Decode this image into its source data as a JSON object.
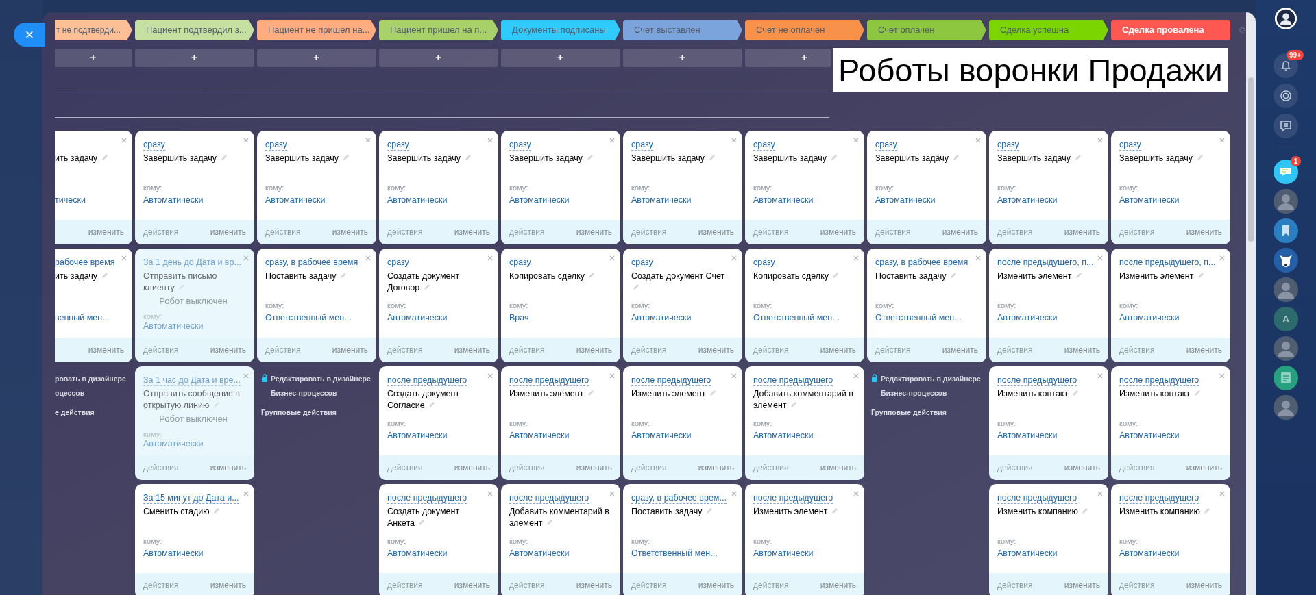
{
  "close_button": {
    "label": "×"
  },
  "stages": [
    {
      "label": "т не подтверди...",
      "color": "#fdbf95",
      "kind": "process"
    },
    {
      "label": "Пациент подтвердил з...",
      "color": "#c5e0a0",
      "kind": "process"
    },
    {
      "label": "Пациент не пришел на...",
      "color": "#ffac80",
      "kind": "process"
    },
    {
      "label": "Пациент пришел на п...",
      "color": "#a8d16a",
      "kind": "process"
    },
    {
      "label": "Документы подписаны",
      "color": "#2fcbfd",
      "kind": "process"
    },
    {
      "label": "Счет выставлен",
      "color": "#7ca4dc",
      "kind": "process"
    },
    {
      "label": "Счет не оплачен",
      "color": "#f8914a",
      "kind": "process"
    },
    {
      "label": "Счет оплачен",
      "color": "#8dc63f",
      "kind": "process"
    },
    {
      "label": "Сделка успешна",
      "color": "#7bd500",
      "kind": "process"
    },
    {
      "label": "Сделка провалена",
      "color": "#ff5752",
      "kind": "failure"
    }
  ],
  "add_buttons": [
    "+",
    "+",
    "+",
    "+",
    "+",
    "+",
    "+"
  ],
  "overlay_title": "Роботы воронки Продажи",
  "columns": [
    {
      "items": [
        {
          "kind": "robot",
          "action": "ить задачу",
          "to_value": "тически",
          "edit_label": "изменить",
          "disabled": false
        },
        {
          "kind": "robot",
          "trigger": "рабочее время",
          "action": "ить задачу",
          "to_value": "венный мен...",
          "edit_label": "изменить",
          "disabled": false
        },
        {
          "kind": "designer",
          "lock": false,
          "link_lines": [
            "ровать в дизайнере",
            "оцессов"
          ],
          "group": "е действия"
        }
      ]
    },
    {
      "items": [
        {
          "kind": "robot",
          "trigger": "сразу",
          "action": "Завершить задачу",
          "to_label": "кому:",
          "to_value": "Автоматически",
          "actions_label": "действия",
          "edit_label": "изменить",
          "disabled": false
        },
        {
          "kind": "robot",
          "trigger": "За 1 день до Дата и вр...",
          "action": "Отправить письмо клиенту",
          "to_label": "кому:",
          "to_value": "Автоматически",
          "actions_label": "действия",
          "edit_label": "изменить",
          "disabled": true,
          "note": "Робот выключен"
        },
        {
          "kind": "robot",
          "trigger": "За 1 час до Дата и вре...",
          "action": "Отправить сообщение в открытую линию",
          "to_label": "кому:",
          "to_value": "Автоматически",
          "actions_label": "действия",
          "edit_label": "изменить",
          "disabled": true,
          "note": "Робот выключен"
        },
        {
          "kind": "robot",
          "trigger": "За 15 минут до Дата и...",
          "action": "Сменить стадию",
          "to_label": "кому:",
          "to_value": "Автоматически",
          "actions_label": "действия",
          "edit_label": "изменить",
          "disabled": false
        }
      ]
    },
    {
      "items": [
        {
          "kind": "robot",
          "trigger": "сразу",
          "action": "Завершить задачу",
          "to_label": "кому:",
          "to_value": "Автоматически",
          "actions_label": "действия",
          "edit_label": "изменить",
          "disabled": false
        },
        {
          "kind": "robot",
          "trigger": "сразу, в рабочее время",
          "action": "Поставить задачу",
          "to_label": "кому:",
          "to_value": "Ответственный мен...",
          "actions_label": "действия",
          "edit_label": "изменить",
          "disabled": false
        },
        {
          "kind": "designer",
          "lock": true,
          "link_lines": [
            "Редактировать в дизайнере",
            "Бизнес-процессов"
          ],
          "group": "Групповые действия"
        }
      ]
    },
    {
      "items": [
        {
          "kind": "robot",
          "trigger": "сразу",
          "action": "Завершить задачу",
          "to_label": "кому:",
          "to_value": "Автоматически",
          "actions_label": "действия",
          "edit_label": "изменить",
          "disabled": false
        },
        {
          "kind": "robot",
          "trigger": "сразу",
          "action": "Создать документ Договор",
          "to_label": "кому:",
          "to_value": "Автоматически",
          "actions_label": "действия",
          "edit_label": "изменить",
          "disabled": false
        },
        {
          "kind": "robot",
          "trigger": "после предыдущего",
          "action": "Создать документ Согласие",
          "to_label": "кому:",
          "to_value": "Автоматически",
          "actions_label": "действия",
          "edit_label": "изменить",
          "disabled": false
        },
        {
          "kind": "robot",
          "trigger": "после предыдущего",
          "action": "Создать документ Анкета",
          "to_label": "кому:",
          "to_value": "Автоматически",
          "actions_label": "действия",
          "edit_label": "изменить",
          "disabled": false
        }
      ]
    },
    {
      "items": [
        {
          "kind": "robot",
          "trigger": "сразу",
          "action": "Завершить задачу",
          "to_label": "кому:",
          "to_value": "Автоматически",
          "actions_label": "действия",
          "edit_label": "изменить",
          "disabled": false
        },
        {
          "kind": "robot",
          "trigger": "сразу",
          "action": "Копировать сделку",
          "to_label": "кому:",
          "to_value": "Врач",
          "actions_label": "действия",
          "edit_label": "изменить",
          "disabled": false
        },
        {
          "kind": "robot",
          "trigger": "после предыдущего",
          "action": "Изменить элемент",
          "to_label": "кому:",
          "to_value": "Автоматически",
          "actions_label": "действия",
          "edit_label": "изменить",
          "disabled": false
        },
        {
          "kind": "robot",
          "trigger": "после предыдущего",
          "action": "Добавить комментарий в элемент",
          "to_label": "кому:",
          "to_value": "Автоматически",
          "actions_label": "действия",
          "edit_label": "изменить",
          "disabled": false
        }
      ]
    },
    {
      "items": [
        {
          "kind": "robot",
          "trigger": "сразу",
          "action": "Завершить задачу",
          "to_label": "кому:",
          "to_value": "Автоматически",
          "actions_label": "действия",
          "edit_label": "изменить",
          "disabled": false
        },
        {
          "kind": "robot",
          "trigger": "сразу",
          "action": "Создать документ Счет",
          "to_label": "кому:",
          "to_value": "Автоматически",
          "actions_label": "действия",
          "edit_label": "изменить",
          "disabled": false
        },
        {
          "kind": "robot",
          "trigger": "после предыдущего",
          "action": "Изменить элемент",
          "to_label": "кому:",
          "to_value": "Автоматически",
          "actions_label": "действия",
          "edit_label": "изменить",
          "disabled": false
        },
        {
          "kind": "robot",
          "trigger": "сразу, в рабочее врем...",
          "action": "Поставить задачу",
          "to_label": "кому:",
          "to_value": "Ответственный мен...",
          "actions_label": "действия",
          "edit_label": "изменить",
          "disabled": false
        }
      ]
    },
    {
      "items": [
        {
          "kind": "robot",
          "trigger": "сразу",
          "action": "Завершить задачу",
          "to_label": "кому:",
          "to_value": "Автоматически",
          "actions_label": "действия",
          "edit_label": "изменить",
          "disabled": false
        },
        {
          "kind": "robot",
          "trigger": "сразу",
          "action": "Копировать сделку",
          "to_label": "кому:",
          "to_value": "Ответственный мен...",
          "actions_label": "действия",
          "edit_label": "изменить",
          "disabled": false
        },
        {
          "kind": "robot",
          "trigger": "после предыдущего",
          "action": "Добавить комментарий в элемент",
          "to_label": "кому:",
          "to_value": "Автоматически",
          "actions_label": "действия",
          "edit_label": "изменить",
          "disabled": false
        },
        {
          "kind": "robot",
          "trigger": "после предыдущего",
          "action": "Изменить элемент",
          "to_label": "кому:",
          "to_value": "Автоматически",
          "actions_label": "действия",
          "edit_label": "изменить",
          "disabled": false
        }
      ]
    },
    {
      "items": [
        {
          "kind": "robot",
          "trigger": "сразу",
          "action": "Завершить задачу",
          "to_label": "кому:",
          "to_value": "Автоматически",
          "actions_label": "действия",
          "edit_label": "изменить",
          "disabled": false
        },
        {
          "kind": "robot",
          "trigger": "сразу, в рабочее время",
          "action": "Поставить задачу",
          "to_label": "кому:",
          "to_value": "Ответственный мен...",
          "actions_label": "действия",
          "edit_label": "изменить",
          "disabled": false
        },
        {
          "kind": "designer",
          "lock": true,
          "link_lines": [
            "Редактировать в дизайнере",
            "Бизнес-процессов"
          ],
          "group": "Групповые действия"
        }
      ]
    },
    {
      "items": [
        {
          "kind": "robot",
          "trigger": "сразу",
          "action": "Завершить задачу",
          "to_label": "кому:",
          "to_value": "Автоматически",
          "actions_label": "действия",
          "edit_label": "изменить",
          "disabled": false
        },
        {
          "kind": "robot",
          "trigger": "после предыдущего, п...",
          "action": "Изменить элемент",
          "to_label": "кому:",
          "to_value": "Автоматически",
          "actions_label": "действия",
          "edit_label": "изменить",
          "disabled": false
        },
        {
          "kind": "robot",
          "trigger": "после предыдущего",
          "action": "Изменить контакт",
          "to_label": "кому:",
          "to_value": "Автоматически",
          "actions_label": "действия",
          "edit_label": "изменить",
          "disabled": false
        },
        {
          "kind": "robot",
          "trigger": "после предыдущего",
          "action": "Изменить компанию",
          "to_label": "кому:",
          "to_value": "Автоматически",
          "actions_label": "действия",
          "edit_label": "изменить",
          "disabled": false
        }
      ]
    },
    {
      "items": [
        {
          "kind": "robot",
          "trigger": "сразу",
          "action": "Завершить задачу",
          "to_label": "кому:",
          "to_value": "Автоматически",
          "actions_label": "действия",
          "edit_label": "изменить",
          "disabled": false
        },
        {
          "kind": "robot",
          "trigger": "после предыдущего, п...",
          "action": "Изменить элемент",
          "to_label": "кому:",
          "to_value": "Автоматически",
          "actions_label": "действия",
          "edit_label": "изменить",
          "disabled": false
        },
        {
          "kind": "robot",
          "trigger": "после предыдущего",
          "action": "Изменить контакт",
          "to_label": "кому:",
          "to_value": "Автоматически",
          "actions_label": "действия",
          "edit_label": "изменить",
          "disabled": false
        },
        {
          "kind": "robot",
          "trigger": "после предыдущего",
          "action": "Изменить компанию",
          "to_label": "кому:",
          "to_value": "Автоматически",
          "actions_label": "действия",
          "edit_label": "изменить",
          "disabled": false
        }
      ]
    }
  ],
  "right_sidebar": {
    "notifications_badge": "99+",
    "chat_badge": "1",
    "contacts": [
      {
        "kind": "photo"
      },
      {
        "kind": "bookmark"
      },
      {
        "kind": "dog"
      },
      {
        "kind": "photo"
      },
      {
        "kind": "letter",
        "letter": "A"
      },
      {
        "kind": "photo"
      },
      {
        "kind": "document"
      },
      {
        "kind": "photo"
      }
    ]
  }
}
